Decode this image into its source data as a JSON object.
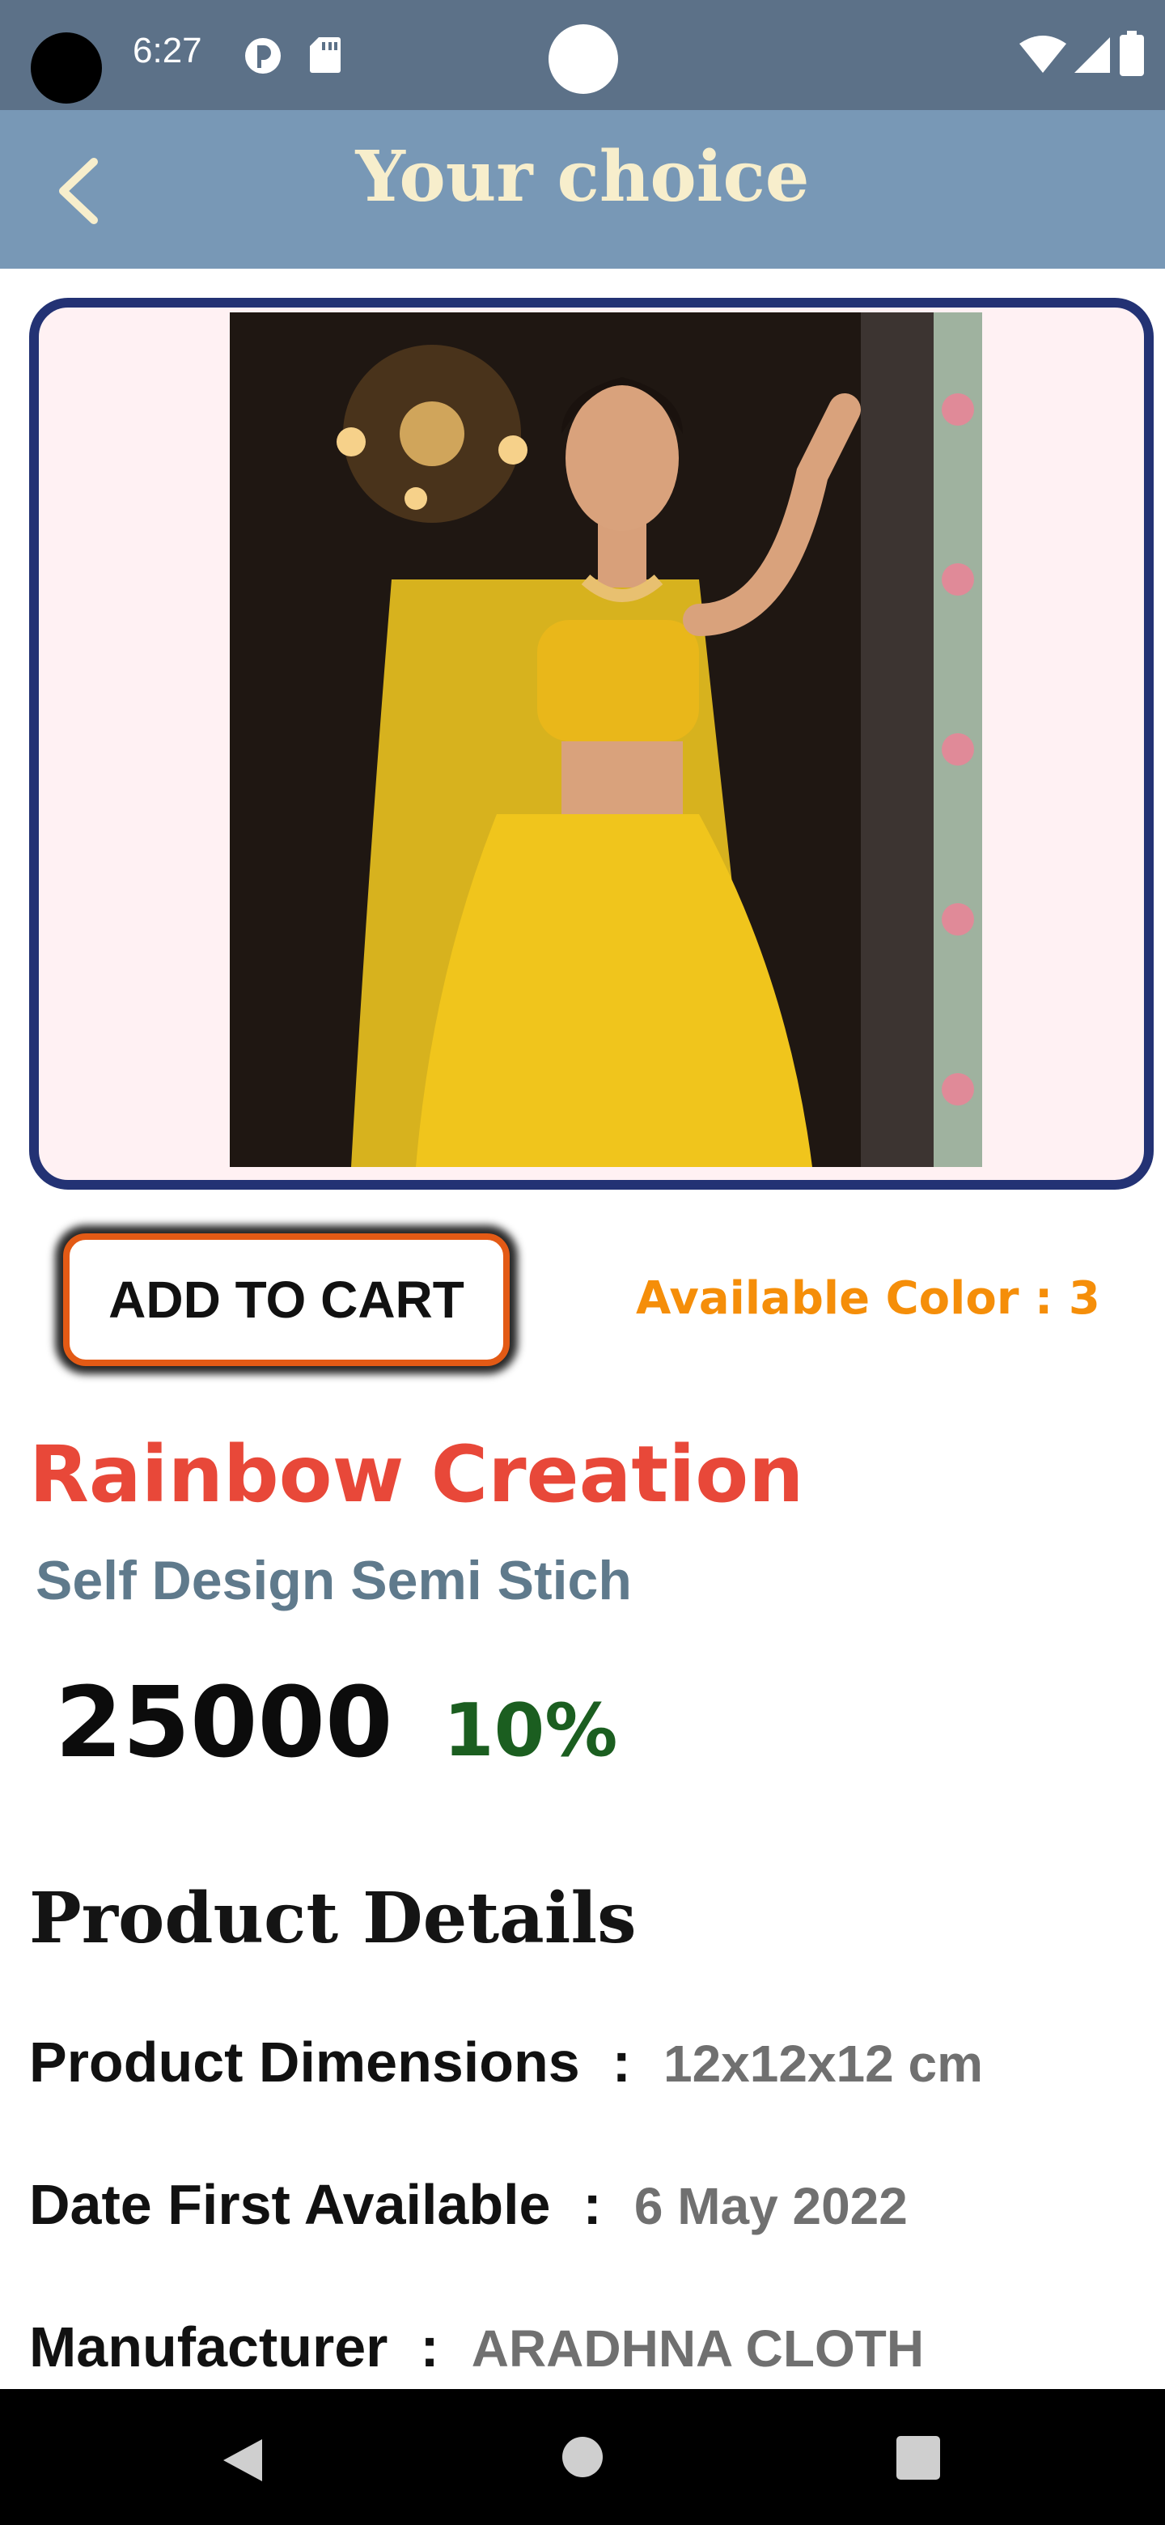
{
  "status_bar": {
    "time": "6:27"
  },
  "app_bar": {
    "title": "Your choice"
  },
  "actions": {
    "add_to_cart": "ADD TO CART",
    "available_color": "Available Color : 3"
  },
  "product": {
    "brand": "Rainbow Creation",
    "name": "Self Design Semi Stich",
    "price": "25000",
    "discount": "10%"
  },
  "details": {
    "heading": "Product Details",
    "rows": [
      {
        "label": "Product Dimensions",
        "sep": ":",
        "value": "12x12x12 cm"
      },
      {
        "label": "Date First Available",
        "sep": ":",
        "value": "6 May 2022"
      },
      {
        "label": "Manufacturer",
        "sep": ":",
        "value": "ARADHNA CLOTH"
      }
    ]
  },
  "colors": {
    "status_bar": "#5c7188",
    "app_bar": "#7898b6",
    "title": "#f7eecc",
    "frame": "#233274",
    "cart_border": "#e35a15",
    "available": "#f58e09",
    "brand": "#e84839",
    "subtitle": "#5f7a8c",
    "discount": "#1b5e20"
  },
  "icons": [
    "back-arrow-icon",
    "wifi-icon",
    "signal-icon",
    "battery-icon",
    "nav-back-icon",
    "nav-home-icon",
    "nav-recents-icon"
  ]
}
